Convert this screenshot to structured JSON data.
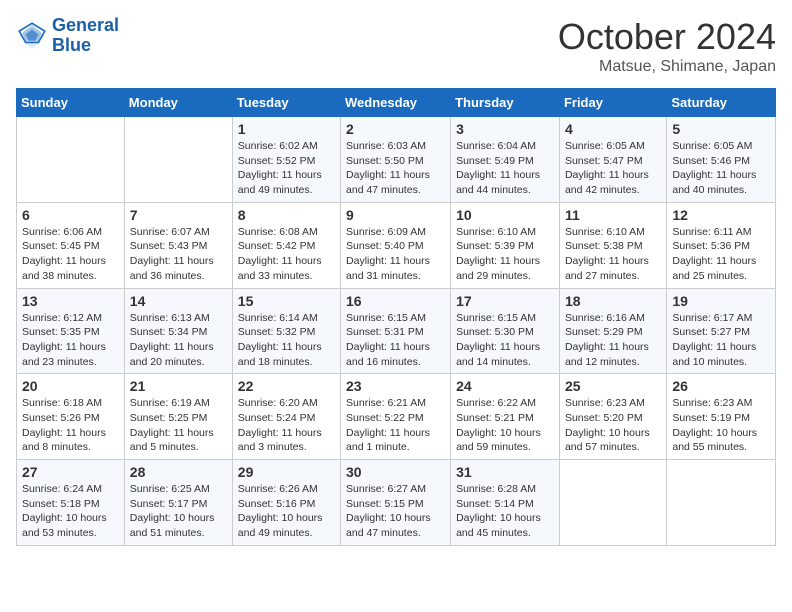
{
  "logo": {
    "line1": "General",
    "line2": "Blue"
  },
  "title": "October 2024",
  "subtitle": "Matsue, Shimane, Japan",
  "days_header": [
    "Sunday",
    "Monday",
    "Tuesday",
    "Wednesday",
    "Thursday",
    "Friday",
    "Saturday"
  ],
  "weeks": [
    [
      {
        "day": "",
        "info": ""
      },
      {
        "day": "",
        "info": ""
      },
      {
        "day": "1",
        "info": "Sunrise: 6:02 AM\nSunset: 5:52 PM\nDaylight: 11 hours and 49 minutes."
      },
      {
        "day": "2",
        "info": "Sunrise: 6:03 AM\nSunset: 5:50 PM\nDaylight: 11 hours and 47 minutes."
      },
      {
        "day": "3",
        "info": "Sunrise: 6:04 AM\nSunset: 5:49 PM\nDaylight: 11 hours and 44 minutes."
      },
      {
        "day": "4",
        "info": "Sunrise: 6:05 AM\nSunset: 5:47 PM\nDaylight: 11 hours and 42 minutes."
      },
      {
        "day": "5",
        "info": "Sunrise: 6:05 AM\nSunset: 5:46 PM\nDaylight: 11 hours and 40 minutes."
      }
    ],
    [
      {
        "day": "6",
        "info": "Sunrise: 6:06 AM\nSunset: 5:45 PM\nDaylight: 11 hours and 38 minutes."
      },
      {
        "day": "7",
        "info": "Sunrise: 6:07 AM\nSunset: 5:43 PM\nDaylight: 11 hours and 36 minutes."
      },
      {
        "day": "8",
        "info": "Sunrise: 6:08 AM\nSunset: 5:42 PM\nDaylight: 11 hours and 33 minutes."
      },
      {
        "day": "9",
        "info": "Sunrise: 6:09 AM\nSunset: 5:40 PM\nDaylight: 11 hours and 31 minutes."
      },
      {
        "day": "10",
        "info": "Sunrise: 6:10 AM\nSunset: 5:39 PM\nDaylight: 11 hours and 29 minutes."
      },
      {
        "day": "11",
        "info": "Sunrise: 6:10 AM\nSunset: 5:38 PM\nDaylight: 11 hours and 27 minutes."
      },
      {
        "day": "12",
        "info": "Sunrise: 6:11 AM\nSunset: 5:36 PM\nDaylight: 11 hours and 25 minutes."
      }
    ],
    [
      {
        "day": "13",
        "info": "Sunrise: 6:12 AM\nSunset: 5:35 PM\nDaylight: 11 hours and 23 minutes."
      },
      {
        "day": "14",
        "info": "Sunrise: 6:13 AM\nSunset: 5:34 PM\nDaylight: 11 hours and 20 minutes."
      },
      {
        "day": "15",
        "info": "Sunrise: 6:14 AM\nSunset: 5:32 PM\nDaylight: 11 hours and 18 minutes."
      },
      {
        "day": "16",
        "info": "Sunrise: 6:15 AM\nSunset: 5:31 PM\nDaylight: 11 hours and 16 minutes."
      },
      {
        "day": "17",
        "info": "Sunrise: 6:15 AM\nSunset: 5:30 PM\nDaylight: 11 hours and 14 minutes."
      },
      {
        "day": "18",
        "info": "Sunrise: 6:16 AM\nSunset: 5:29 PM\nDaylight: 11 hours and 12 minutes."
      },
      {
        "day": "19",
        "info": "Sunrise: 6:17 AM\nSunset: 5:27 PM\nDaylight: 11 hours and 10 minutes."
      }
    ],
    [
      {
        "day": "20",
        "info": "Sunrise: 6:18 AM\nSunset: 5:26 PM\nDaylight: 11 hours and 8 minutes."
      },
      {
        "day": "21",
        "info": "Sunrise: 6:19 AM\nSunset: 5:25 PM\nDaylight: 11 hours and 5 minutes."
      },
      {
        "day": "22",
        "info": "Sunrise: 6:20 AM\nSunset: 5:24 PM\nDaylight: 11 hours and 3 minutes."
      },
      {
        "day": "23",
        "info": "Sunrise: 6:21 AM\nSunset: 5:22 PM\nDaylight: 11 hours and 1 minute."
      },
      {
        "day": "24",
        "info": "Sunrise: 6:22 AM\nSunset: 5:21 PM\nDaylight: 10 hours and 59 minutes."
      },
      {
        "day": "25",
        "info": "Sunrise: 6:23 AM\nSunset: 5:20 PM\nDaylight: 10 hours and 57 minutes."
      },
      {
        "day": "26",
        "info": "Sunrise: 6:23 AM\nSunset: 5:19 PM\nDaylight: 10 hours and 55 minutes."
      }
    ],
    [
      {
        "day": "27",
        "info": "Sunrise: 6:24 AM\nSunset: 5:18 PM\nDaylight: 10 hours and 53 minutes."
      },
      {
        "day": "28",
        "info": "Sunrise: 6:25 AM\nSunset: 5:17 PM\nDaylight: 10 hours and 51 minutes."
      },
      {
        "day": "29",
        "info": "Sunrise: 6:26 AM\nSunset: 5:16 PM\nDaylight: 10 hours and 49 minutes."
      },
      {
        "day": "30",
        "info": "Sunrise: 6:27 AM\nSunset: 5:15 PM\nDaylight: 10 hours and 47 minutes."
      },
      {
        "day": "31",
        "info": "Sunrise: 6:28 AM\nSunset: 5:14 PM\nDaylight: 10 hours and 45 minutes."
      },
      {
        "day": "",
        "info": ""
      },
      {
        "day": "",
        "info": ""
      }
    ]
  ]
}
